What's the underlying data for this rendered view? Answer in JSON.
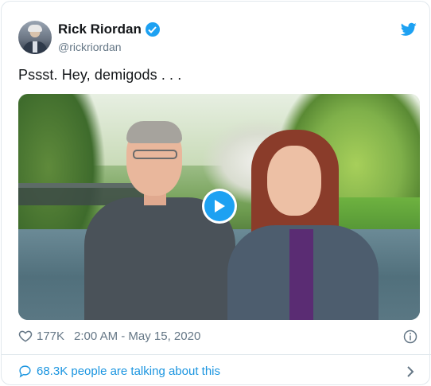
{
  "author": {
    "name": "Rick Riordan",
    "handle": "@rickriordan",
    "verified": true
  },
  "tweet": {
    "text": "Pssst. Hey, demigods . . .",
    "media_type": "video"
  },
  "footer": {
    "likes": "177K",
    "timestamp": "2:00 AM - May 15, 2020"
  },
  "conversation": {
    "label": "68.3K people are talking about this"
  },
  "icons": {
    "brand": "twitter-bird-icon",
    "verified": "verified-badge-icon",
    "like": "heart-icon",
    "info": "info-icon",
    "conversation": "speech-bubble-icon",
    "more": "chevron-right-icon",
    "play": "play-icon"
  },
  "colors": {
    "accent": "#1da1f2",
    "link": "#1b95e0",
    "secondary_text": "#657786",
    "primary_text": "#14171a",
    "border": "#e1e8ed"
  }
}
